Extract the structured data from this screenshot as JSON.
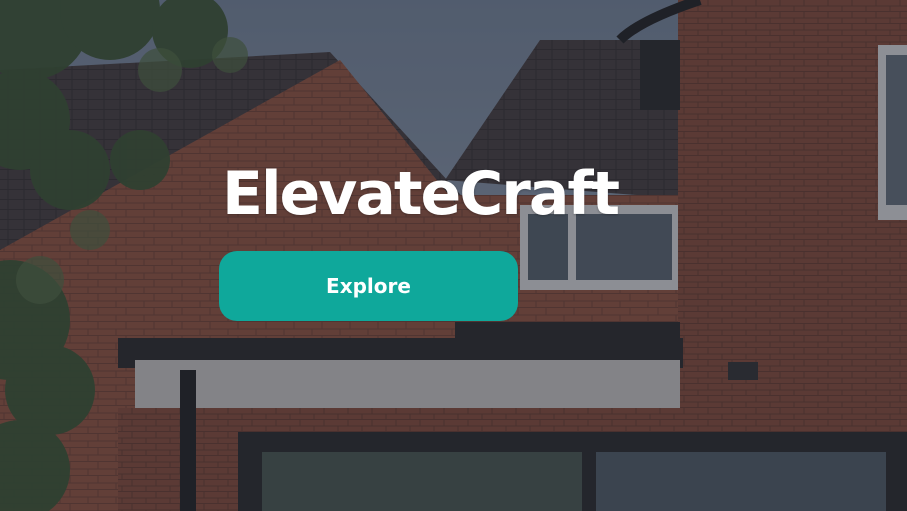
{
  "hero": {
    "title": "ElevateCraft",
    "cta_label": "Explore",
    "background_image": "brick-house-exterior-photo"
  },
  "colors": {
    "accent": "#0fa89b",
    "title_text": "#ffffff",
    "overlay": "#1c222e"
  }
}
